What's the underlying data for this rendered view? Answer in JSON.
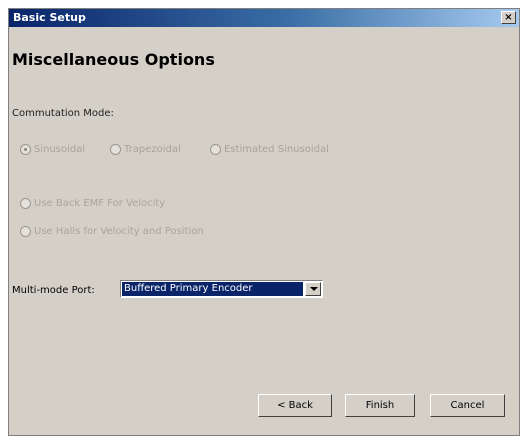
{
  "window": {
    "title": "Basic Setup",
    "close_glyph": "×"
  },
  "heading": "Miscellaneous Options",
  "commutation": {
    "label": "Commutation Mode:",
    "options": [
      "Sinusoidal",
      "Trapezoidal",
      "Estimated Sinusoidal"
    ],
    "selected": "Sinusoidal",
    "enabled": false
  },
  "velocity_options": {
    "enabled": false,
    "items": [
      "Use Back EMF For Velocity",
      "Use Halls for Velocity and Position"
    ]
  },
  "multimode_port": {
    "label": "Multi-mode Port:",
    "value": "Buffered Primary Encoder"
  },
  "buttons": {
    "back": "< Back",
    "finish": "Finish",
    "cancel": "Cancel"
  },
  "colors": {
    "titlebar": "#0a246a",
    "face": "#d4d0c8",
    "selection": "#0a246a",
    "disabled_text": "#a8a49c"
  },
  "icons": {
    "close": "close-icon",
    "dropdown": "chevron-down-icon"
  }
}
